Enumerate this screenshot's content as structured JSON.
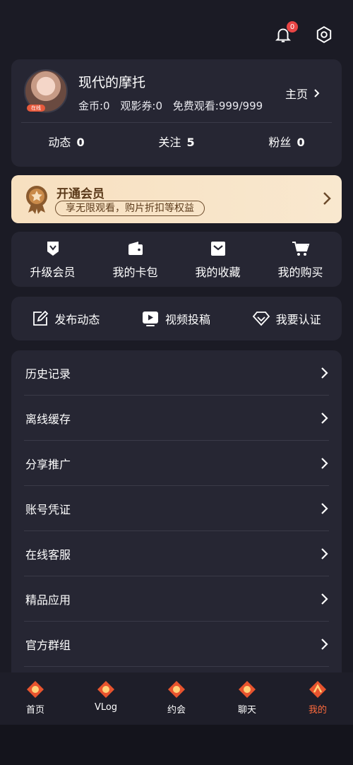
{
  "notifications": {
    "count": "0"
  },
  "profile": {
    "name": "现代的摩托",
    "avatar_tag": "在线",
    "coins": "金币:0",
    "tickets": "观影券:0",
    "free_views": "免费观看:999/999",
    "homepage_label": "主页",
    "counts": [
      {
        "label": "动态",
        "value": "0"
      },
      {
        "label": "关注",
        "value": "5"
      },
      {
        "label": "粉丝",
        "value": "0"
      }
    ]
  },
  "vip": {
    "title": "开通会员",
    "subtitle": "享无限观看，购片折扣等权益"
  },
  "quick_menu": [
    {
      "label": "升级会员",
      "icon": "diamond-ticket-icon"
    },
    {
      "label": "我的卡包",
      "icon": "wallet-icon"
    },
    {
      "label": "我的收藏",
      "icon": "favorite-icon"
    },
    {
      "label": "我的购买",
      "icon": "cart-icon"
    }
  ],
  "actions": [
    {
      "label": "发布动态",
      "icon": "edit-icon"
    },
    {
      "label": "视频投稿",
      "icon": "video-icon"
    },
    {
      "label": "我要认证",
      "icon": "diamond-icon"
    }
  ],
  "menu": [
    {
      "label": "历史记录"
    },
    {
      "label": "离线缓存"
    },
    {
      "label": "分享推广"
    },
    {
      "label": "账号凭证"
    },
    {
      "label": "在线客服"
    },
    {
      "label": "精品应用"
    },
    {
      "label": "官方群组"
    }
  ],
  "tabs": [
    {
      "label": "首页"
    },
    {
      "label": "VLog"
    },
    {
      "label": "约会"
    },
    {
      "label": "聊天"
    },
    {
      "label": "我的"
    }
  ],
  "colors": {
    "background": "#1b1b25",
    "card": "#262633",
    "vip_gradient_start": "#f7e0c0",
    "vip_text": "#5b3a1a",
    "active_tab": "#ff6b3d",
    "badge": "#e84545"
  }
}
